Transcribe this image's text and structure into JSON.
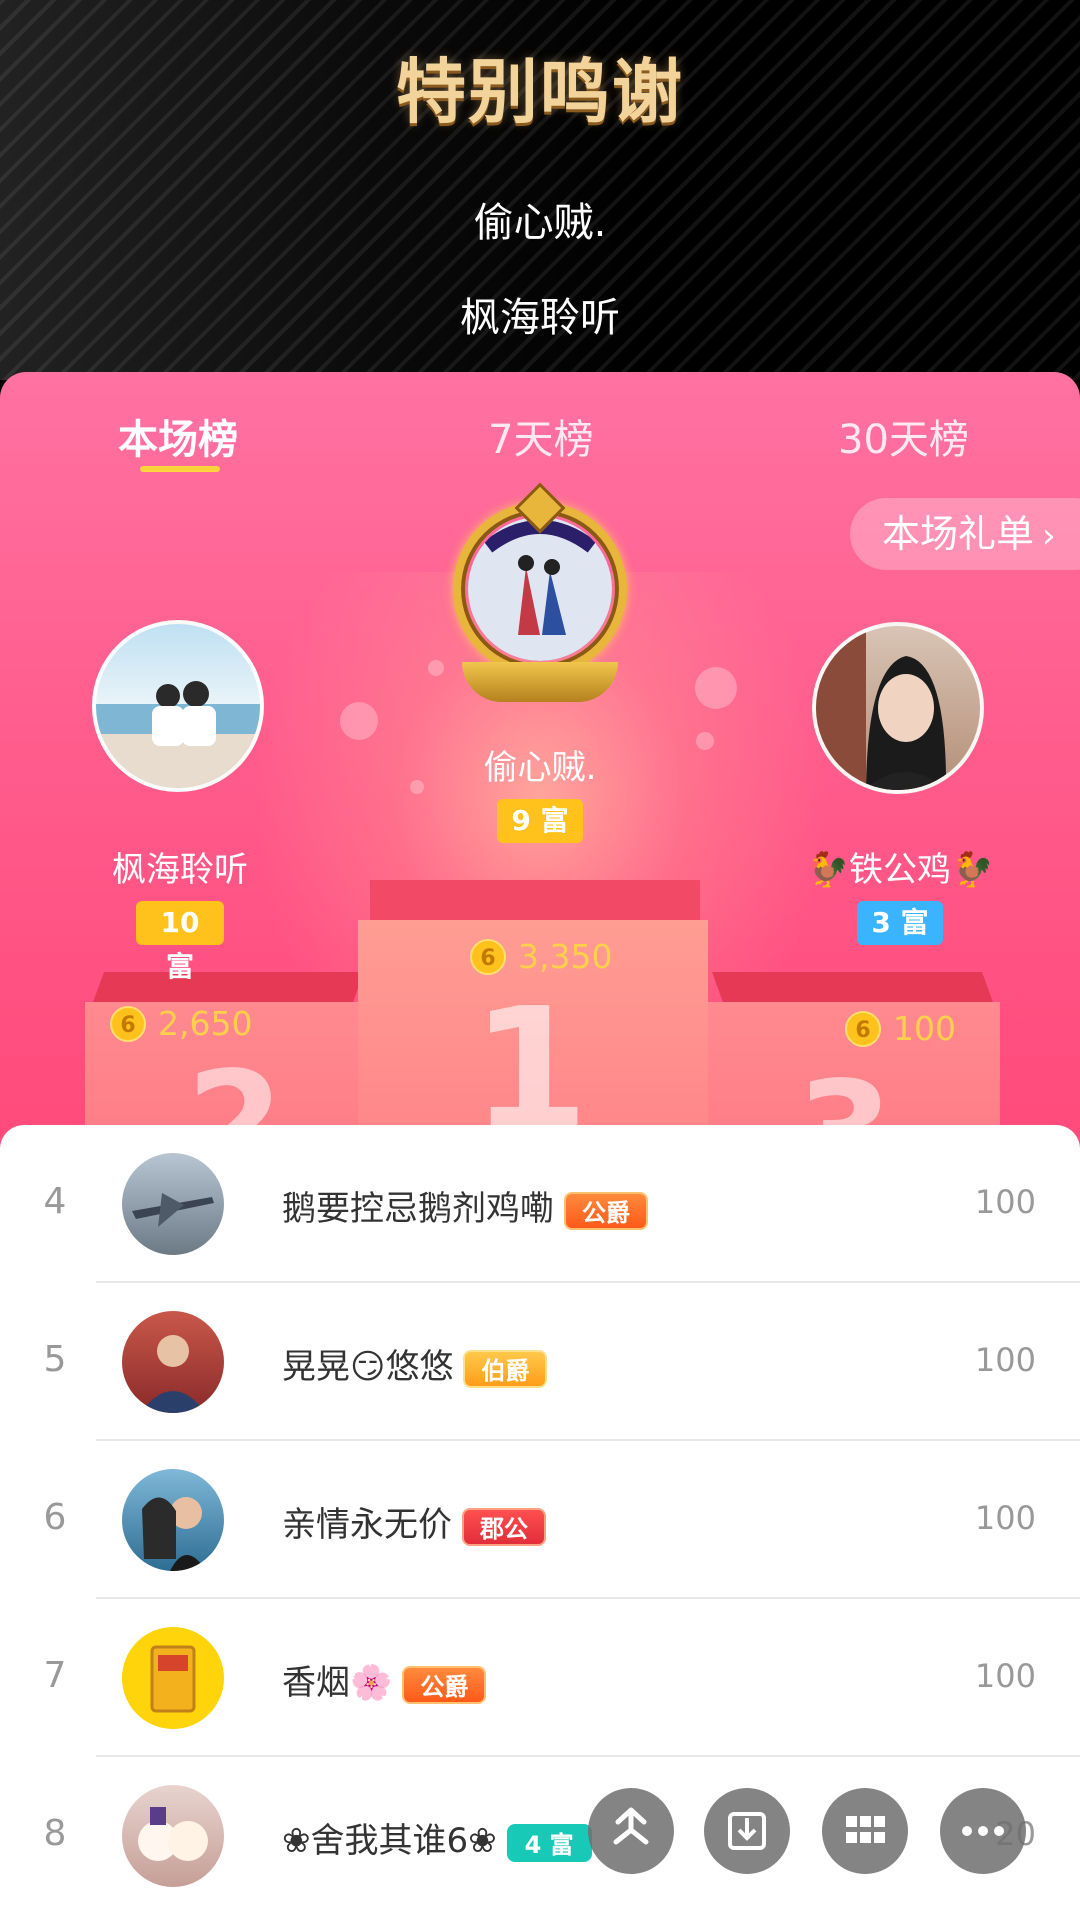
{
  "thanks": {
    "title": "特别鸣谢",
    "names": [
      "偷心贼.",
      "枫海聆听"
    ]
  },
  "tabs": [
    {
      "label": "本场榜",
      "active": true
    },
    {
      "label": "7天榜",
      "active": false
    },
    {
      "label": "30天榜",
      "active": false
    }
  ],
  "gift_list": {
    "label": "本场礼单",
    "icon": "chevron-right-icon"
  },
  "podium": {
    "first": {
      "name": "偷心贼.",
      "rich": "9 富",
      "coins": "3,350",
      "rank": "1"
    },
    "second": {
      "name": "枫海聆听",
      "rich": "10 富",
      "coins": "2,650",
      "rank": "2"
    },
    "third": {
      "name": "🐓铁公鸡🐓",
      "rich": "3 富",
      "coins": "100",
      "rank": "3"
    },
    "coin_symbol": "6"
  },
  "list": [
    {
      "rank": "4",
      "name": "鹅要控忌鹅剂鸡嘞",
      "badge": "公爵",
      "score": "100"
    },
    {
      "rank": "5",
      "name": "晃晃😏悠悠",
      "badge": "伯爵",
      "score": "100"
    },
    {
      "rank": "6",
      "name": "亲情永无价",
      "badge": "郡公",
      "score": "100"
    },
    {
      "rank": "7",
      "name": "香烟🌸",
      "badge": "公爵",
      "score": "100"
    },
    {
      "rank": "8",
      "name": "❀舍我其谁6❀",
      "badge": "4 富",
      "score": "20"
    }
  ],
  "fabs": [
    "share-icon",
    "download-icon",
    "grid-icon",
    "more-icon"
  ],
  "colors": {
    "pink": "#ff5e8e",
    "gold": "#ffc21c",
    "blue": "#3ab4ff",
    "teal": "#19c9b8"
  }
}
